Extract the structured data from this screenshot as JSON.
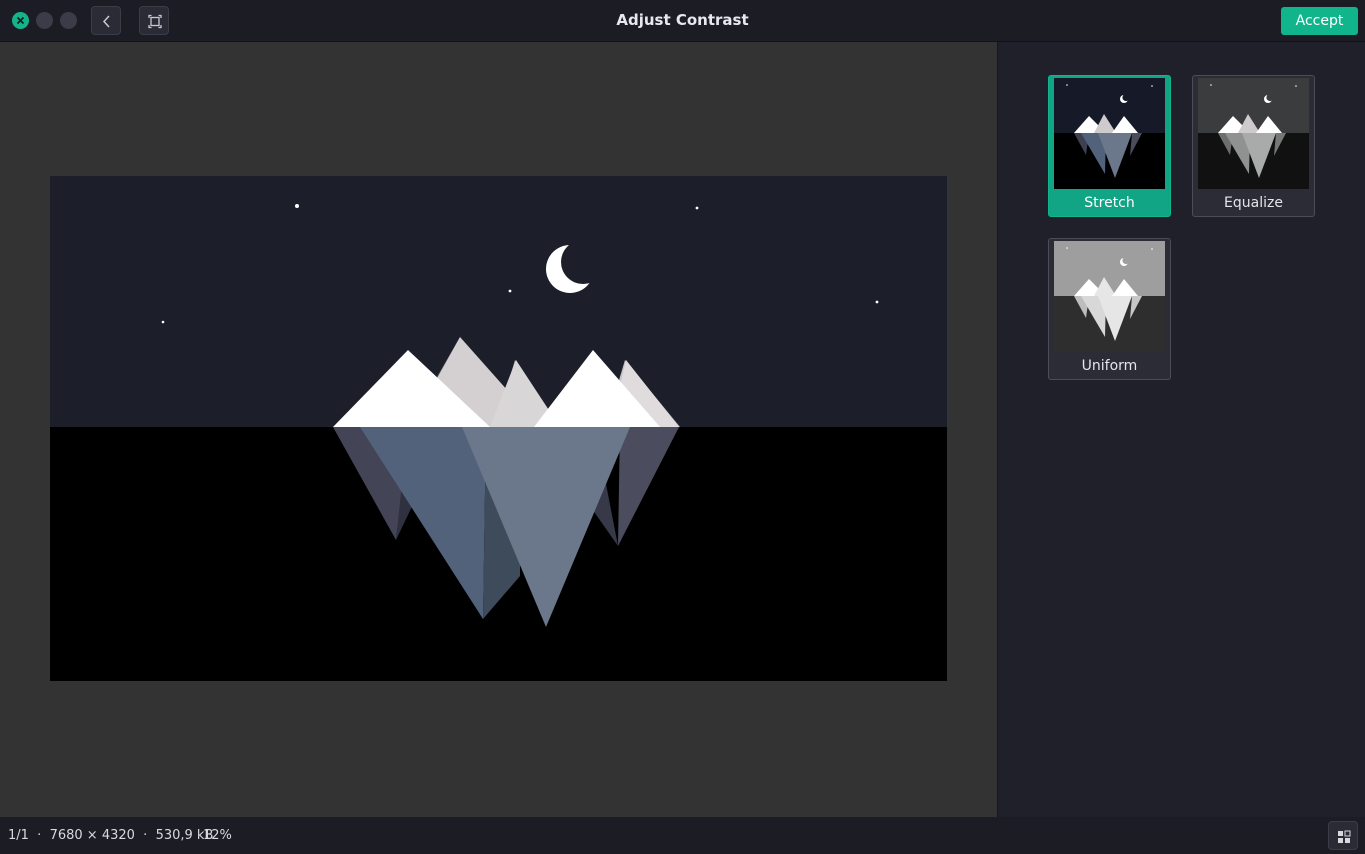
{
  "window": {
    "title": "Adjust Contrast",
    "accept_label": "Accept",
    "accent_color": "#11b58c"
  },
  "icons": {
    "close": "close-icon",
    "back": "chevron-left-icon",
    "fit": "fit-screen-icon",
    "grid": "grid-view-icon"
  },
  "contrast_options": [
    {
      "label": "Stretch",
      "selected": true
    },
    {
      "label": "Equalize",
      "selected": false
    },
    {
      "label": "Uniform",
      "selected": false
    }
  ],
  "status": {
    "info": "1/1  ·  7680 × 4320  ·  530,9 kB",
    "zoom": "12%"
  }
}
